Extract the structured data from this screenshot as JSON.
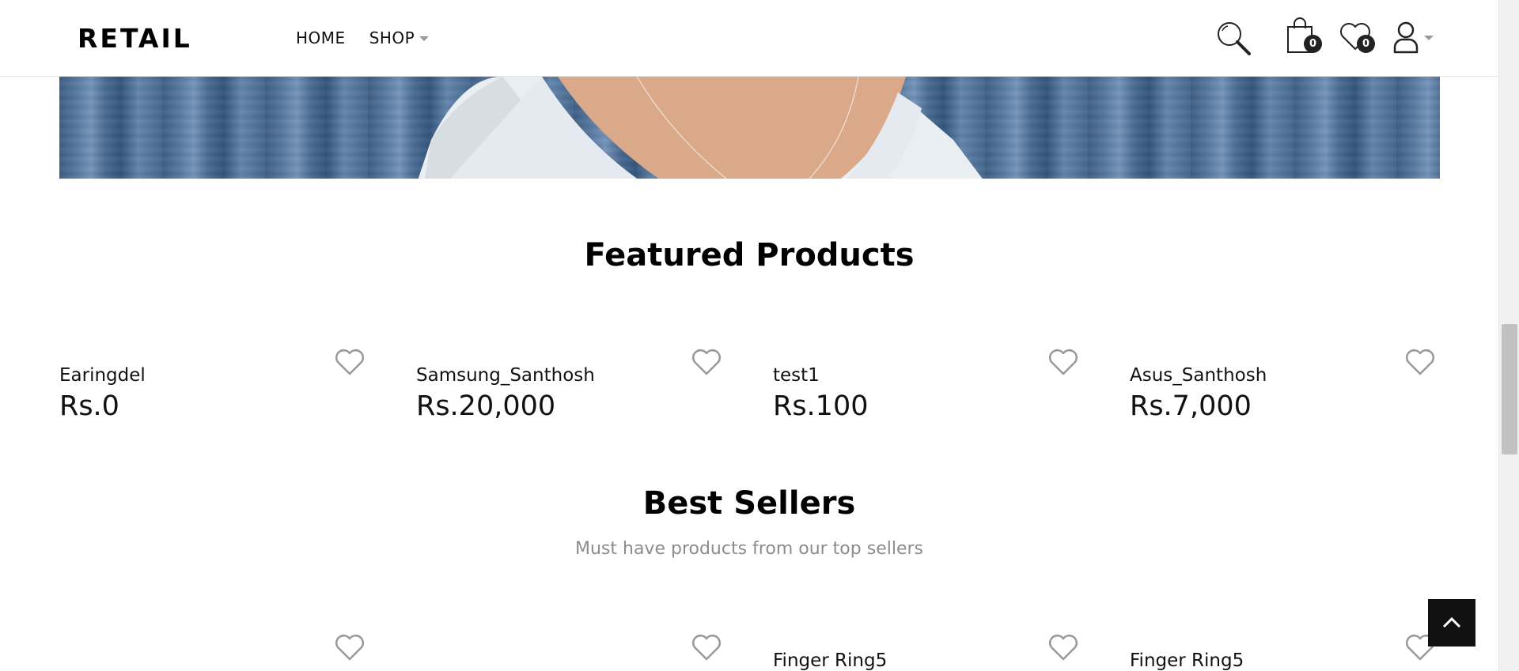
{
  "header": {
    "logo": "RETAIL",
    "nav": [
      {
        "label": "HOME",
        "has_caret": false
      },
      {
        "label": "SHOP",
        "has_caret": true
      }
    ],
    "cart_count": "0",
    "wishlist_count": "0"
  },
  "featured": {
    "title": "Featured Products",
    "products": [
      {
        "name": "Earingdel",
        "price": "Rs.0"
      },
      {
        "name": "Samsung_Santhosh",
        "price": "Rs.20,000"
      },
      {
        "name": "test1",
        "price": "Rs.100"
      },
      {
        "name": "Asus_Santhosh",
        "price": "Rs.7,000"
      }
    ]
  },
  "best_sellers": {
    "title": "Best Sellers",
    "subtitle": "Must have products from our top sellers",
    "products": [
      {
        "name": ""
      },
      {
        "name": ""
      },
      {
        "name": "Finger Ring5"
      },
      {
        "name": "Finger Ring5"
      }
    ]
  },
  "colors": {
    "text": "#111111",
    "muted": "#8c8c8c",
    "accent_dark": "#111111",
    "hero_blue": "#4b6c93"
  },
  "icons": [
    "search-icon",
    "cart-icon",
    "wishlist-icon",
    "user-icon",
    "heart-icon",
    "chevron-up-icon"
  ]
}
